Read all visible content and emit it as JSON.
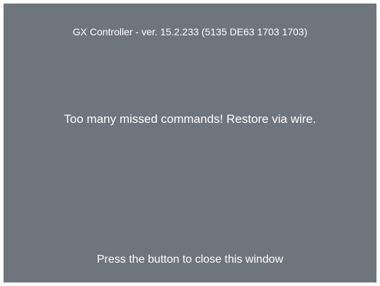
{
  "window": {
    "background_color": "#6f757d",
    "text_color": "#ffffff"
  },
  "header": {
    "title": "GX Controller - ver. 15.2.233 (5135 DE63 1703 1703)"
  },
  "main": {
    "message": "Too many missed commands! Restore via wire."
  },
  "footer": {
    "hint": "Press the button to close this window"
  }
}
